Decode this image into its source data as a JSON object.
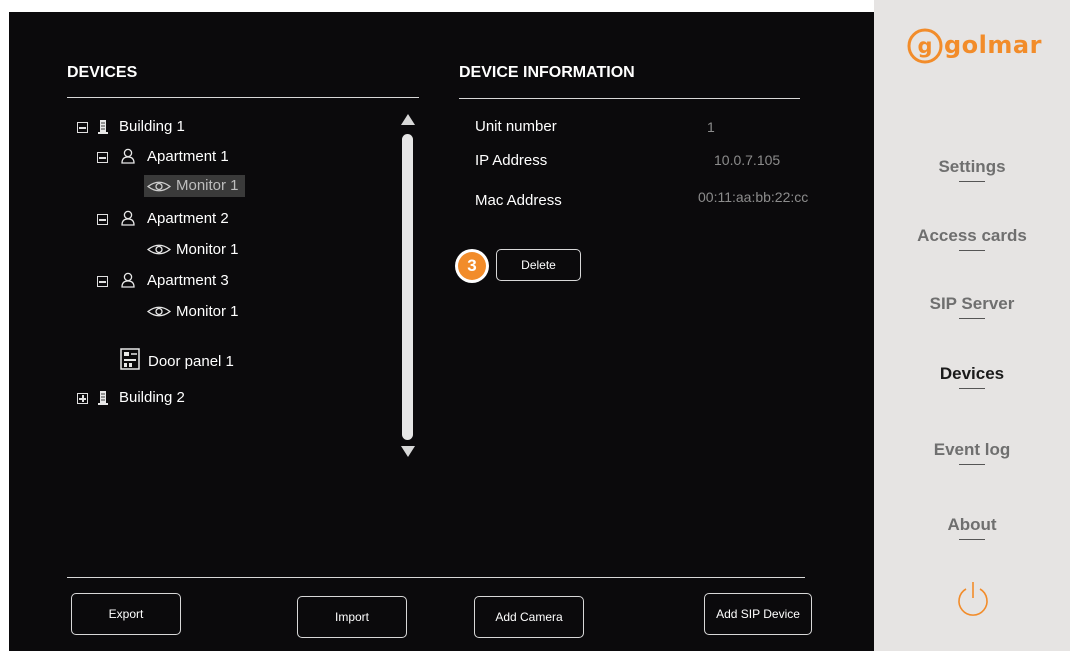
{
  "devices_panel": {
    "title": "DEVICES",
    "tree": {
      "building1": "Building 1",
      "apartment1": "Apartment 1",
      "monitor_a1": "Monitor 1",
      "apartment2": "Apartment 2",
      "monitor_a2": "Monitor 1",
      "apartment3": "Apartment 3",
      "monitor_a3": "Monitor 1",
      "door_panel": "Door panel 1",
      "building2": "Building 2"
    }
  },
  "info_panel": {
    "title": "DEVICE INFORMATION",
    "unit_label": "Unit number",
    "unit_value": "1",
    "ip_label": "IP Address",
    "ip_value": "10.0.7.105",
    "mac_label": "Mac Address",
    "mac_value": "00:11:aa:bb:22:cc",
    "step_badge": "3",
    "delete_label": "Delete"
  },
  "footer": {
    "export": "Export",
    "import": "Import",
    "add_camera": "Add Camera",
    "add_sip": "Add SIP Device"
  },
  "sidebar": {
    "brand": "golmar",
    "items": [
      "Settings",
      "Access cards",
      "SIP Server",
      "Devices",
      "Event log",
      "About"
    ],
    "active": "Devices",
    "power_icon": "power-icon"
  },
  "colors": {
    "background": "#0b0a0c",
    "sidebar": "#e6e4e3",
    "accent": "#f28c2a",
    "selected_row": "#3a3a3a"
  }
}
